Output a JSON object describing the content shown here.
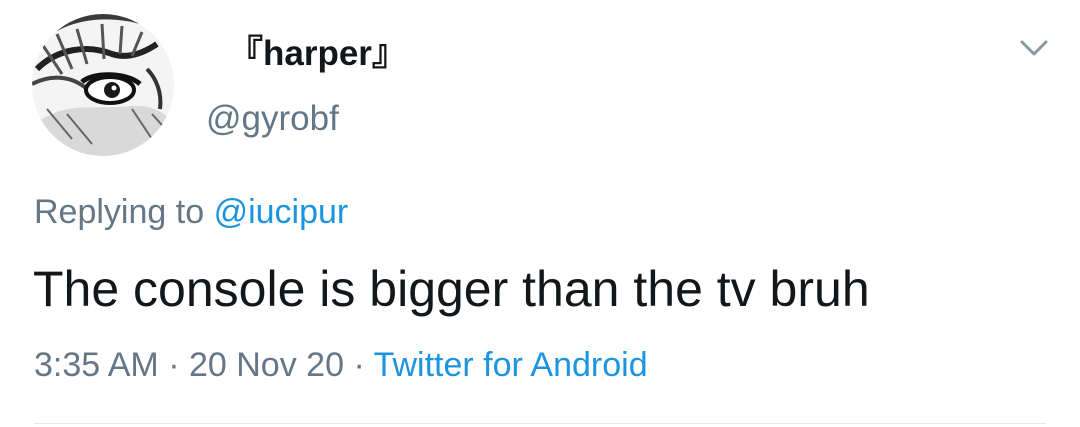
{
  "user": {
    "display_name": "『harper』",
    "handle": "@gyrobf"
  },
  "reply": {
    "prefix": "Replying to",
    "mention": "@iucipur"
  },
  "tweet": {
    "text": "The console is bigger than the tv bruh"
  },
  "meta": {
    "time": "3:35 AM",
    "separator1": "·",
    "date": "20 Nov 20",
    "separator2": "·",
    "source": "Twitter for Android"
  },
  "icons": {
    "avatar": "avatar-sketch-eye-icon",
    "menu": "chevron-down-icon"
  },
  "colors": {
    "text": "#14171a",
    "secondary": "#657786",
    "link": "#1b95e0"
  }
}
